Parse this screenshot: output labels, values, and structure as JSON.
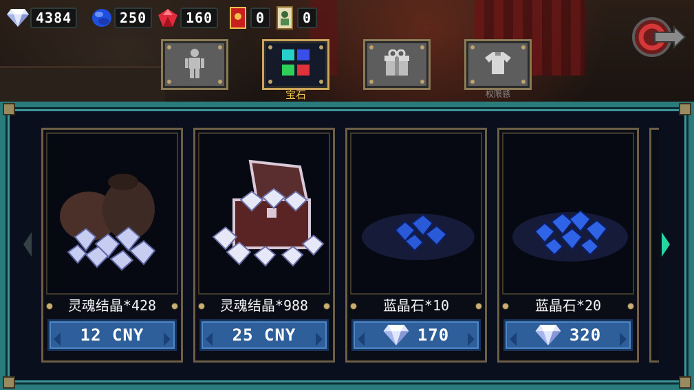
{
  "currencies": [
    {
      "name": "diamond",
      "icon": "diamond-icon",
      "value": "4384"
    },
    {
      "name": "sapphire",
      "icon": "blue-gem-icon",
      "value": "250"
    },
    {
      "name": "ruby",
      "icon": "red-gem-icon",
      "value": "160"
    },
    {
      "name": "red-envelope",
      "icon": "red-envelope-icon",
      "value": "0"
    },
    {
      "name": "card",
      "icon": "portrait-card-icon",
      "value": "0"
    }
  ],
  "tabs": [
    {
      "icon": "character-icon",
      "label": "",
      "active": false
    },
    {
      "icon": "gems-icon",
      "label": "宝石",
      "active": true
    },
    {
      "icon": "gift-box-icon",
      "label": "",
      "active": false
    },
    {
      "icon": "shirt-icon",
      "label": "权限感",
      "active": false
    }
  ],
  "back_button_icon": "back-arrow-icon",
  "items": [
    {
      "name": "灵魂结晶*428",
      "price": "12 CNY",
      "price_icon": "",
      "art": "soul-crystal-bag-icon"
    },
    {
      "name": "灵魂结晶*988",
      "price": "25 CNY",
      "price_icon": "",
      "art": "soul-crystal-chest-icon"
    },
    {
      "name": "蓝晶石*10",
      "price": "170",
      "price_icon": "diamond-icon",
      "art": "blue-crystal-small-pile-icon"
    },
    {
      "name": "蓝晶石*20",
      "price": "320",
      "price_icon": "diamond-icon",
      "art": "blue-crystal-large-pile-icon"
    }
  ],
  "colors": {
    "panel_border": "#2a7b7c",
    "price_button": "#2f5f9a",
    "active_tab_label": "#f2c04c",
    "next_arrow": "#25d6a2"
  }
}
